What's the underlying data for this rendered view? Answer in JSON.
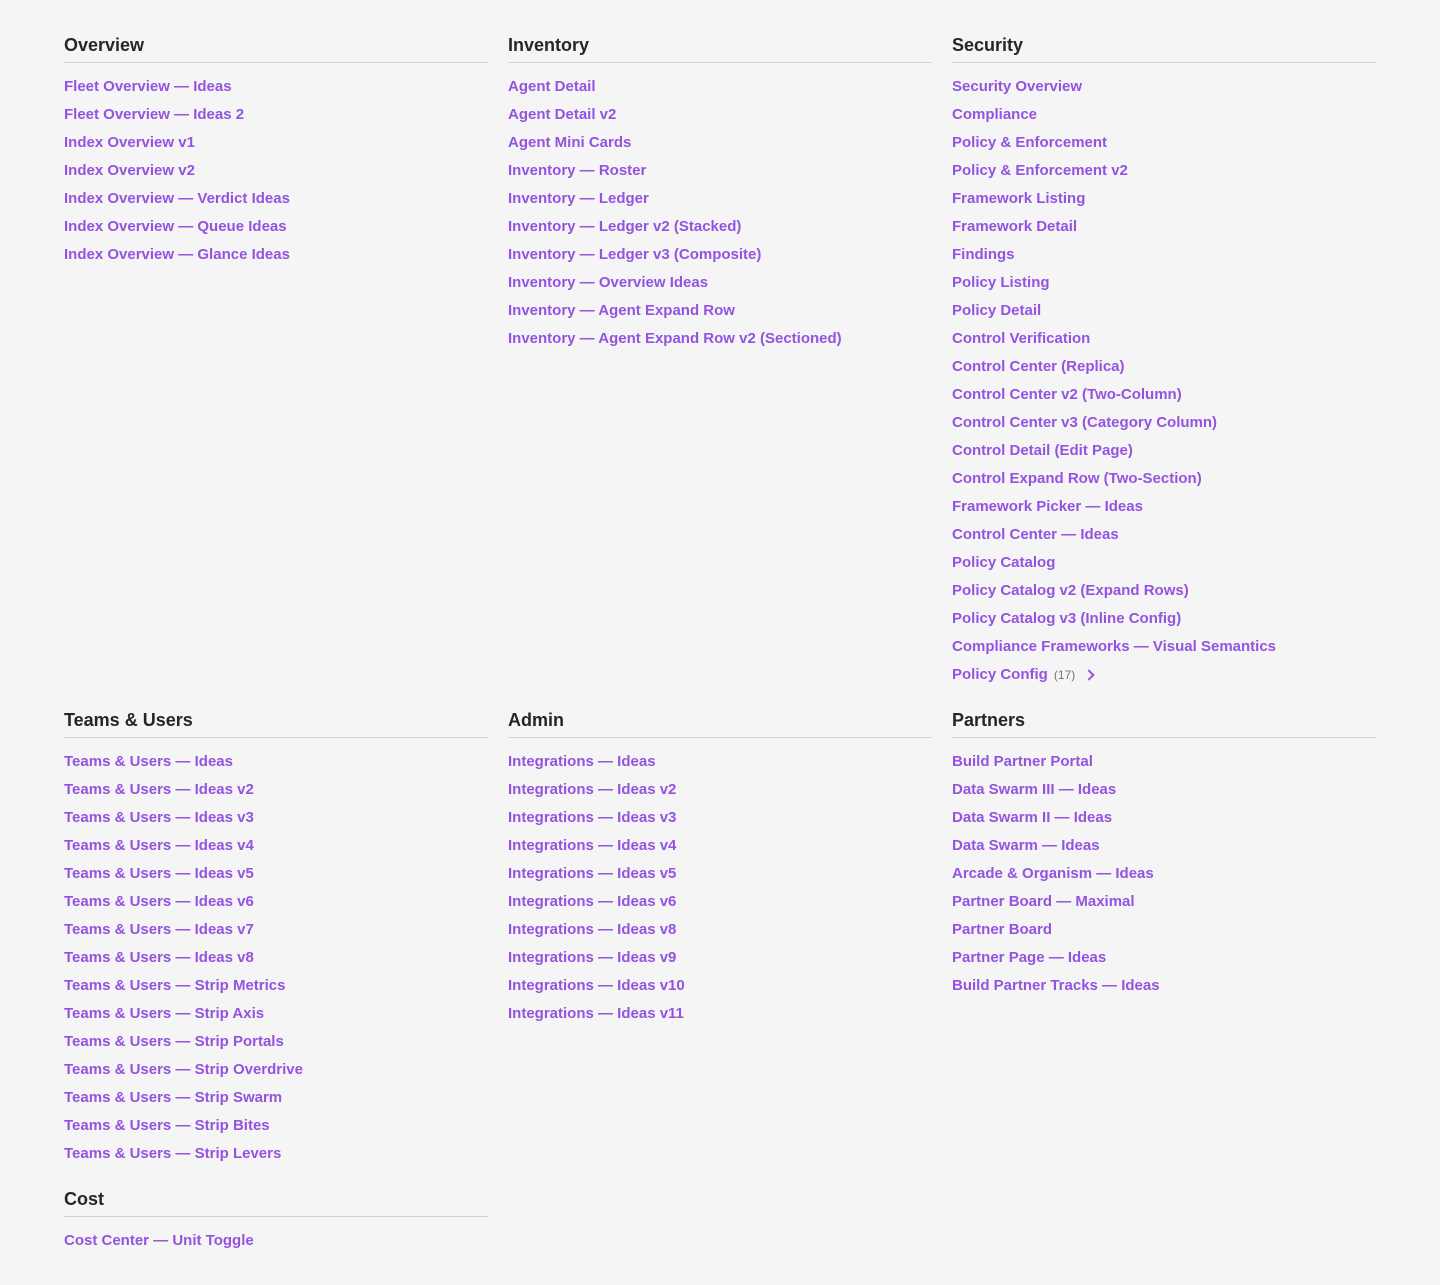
{
  "sections": {
    "overview": {
      "title": "Overview",
      "items": [
        "Fleet Overview — Ideas",
        "Fleet Overview — Ideas 2",
        "Index Overview v1",
        "Index Overview v2",
        "Index Overview — Verdict Ideas",
        "Index Overview — Queue Ideas",
        "Index Overview — Glance Ideas"
      ]
    },
    "inventory": {
      "title": "Inventory",
      "items": [
        "Agent Detail",
        "Agent Detail v2",
        "Agent Mini Cards",
        "Inventory — Roster",
        "Inventory — Ledger",
        "Inventory — Ledger v2 (Stacked)",
        "Inventory — Ledger v3 (Composite)",
        "Inventory — Overview Ideas",
        "Inventory — Agent Expand Row",
        "Inventory — Agent Expand Row v2 (Sectioned)"
      ]
    },
    "security": {
      "title": "Security",
      "items": [
        "Security Overview",
        "Compliance",
        "Policy & Enforcement",
        "Policy & Enforcement v2",
        "Framework Listing",
        "Framework Detail",
        "Findings",
        "Policy Listing",
        "Policy Detail",
        "Control Verification",
        "Control Center (Replica)",
        "Control Center v2 (Two-Column)",
        "Control Center v3 (Category Column)",
        "Control Detail (Edit Page)",
        "Control Expand Row (Two-Section)",
        "Framework Picker — Ideas",
        "Control Center — Ideas",
        "Policy Catalog",
        "Policy Catalog v2 (Expand Rows)",
        "Policy Catalog v3 (Inline Config)",
        "Compliance Frameworks — Visual Semantics"
      ],
      "group": {
        "label": "Policy Config",
        "count": "(17)"
      }
    },
    "teams_users": {
      "title": "Teams & Users",
      "items": [
        "Teams & Users — Ideas",
        "Teams & Users — Ideas v2",
        "Teams & Users — Ideas v3",
        "Teams & Users — Ideas v4",
        "Teams & Users — Ideas v5",
        "Teams & Users — Ideas v6",
        "Teams & Users — Ideas v7",
        "Teams & Users — Ideas v8",
        "Teams & Users — Strip Metrics",
        "Teams & Users — Strip Axis",
        "Teams & Users — Strip Portals",
        "Teams & Users — Strip Overdrive",
        "Teams & Users — Strip Swarm",
        "Teams & Users — Strip Bites",
        "Teams & Users — Strip Levers"
      ]
    },
    "admin": {
      "title": "Admin",
      "items": [
        "Integrations — Ideas",
        "Integrations — Ideas v2",
        "Integrations — Ideas v3",
        "Integrations — Ideas v4",
        "Integrations — Ideas v5",
        "Integrations — Ideas v6",
        "Integrations — Ideas v8",
        "Integrations — Ideas v9",
        "Integrations — Ideas v10",
        "Integrations — Ideas v11"
      ]
    },
    "partners": {
      "title": "Partners",
      "items": [
        "Build Partner Portal",
        "Data Swarm III — Ideas",
        "Data Swarm II — Ideas",
        "Data Swarm — Ideas",
        "Arcade & Organism — Ideas",
        "Partner Board — Maximal",
        "Partner Board",
        "Partner Page — Ideas",
        "Build Partner Tracks — Ideas"
      ]
    },
    "cost": {
      "title": "Cost",
      "items": [
        "Cost Center — Unit Toggle"
      ]
    }
  },
  "colors": {
    "link": "#9453e0",
    "heading": "#262626",
    "divider": "#d4d4d4",
    "background": "#f5f5f5",
    "muted": "#737373"
  }
}
